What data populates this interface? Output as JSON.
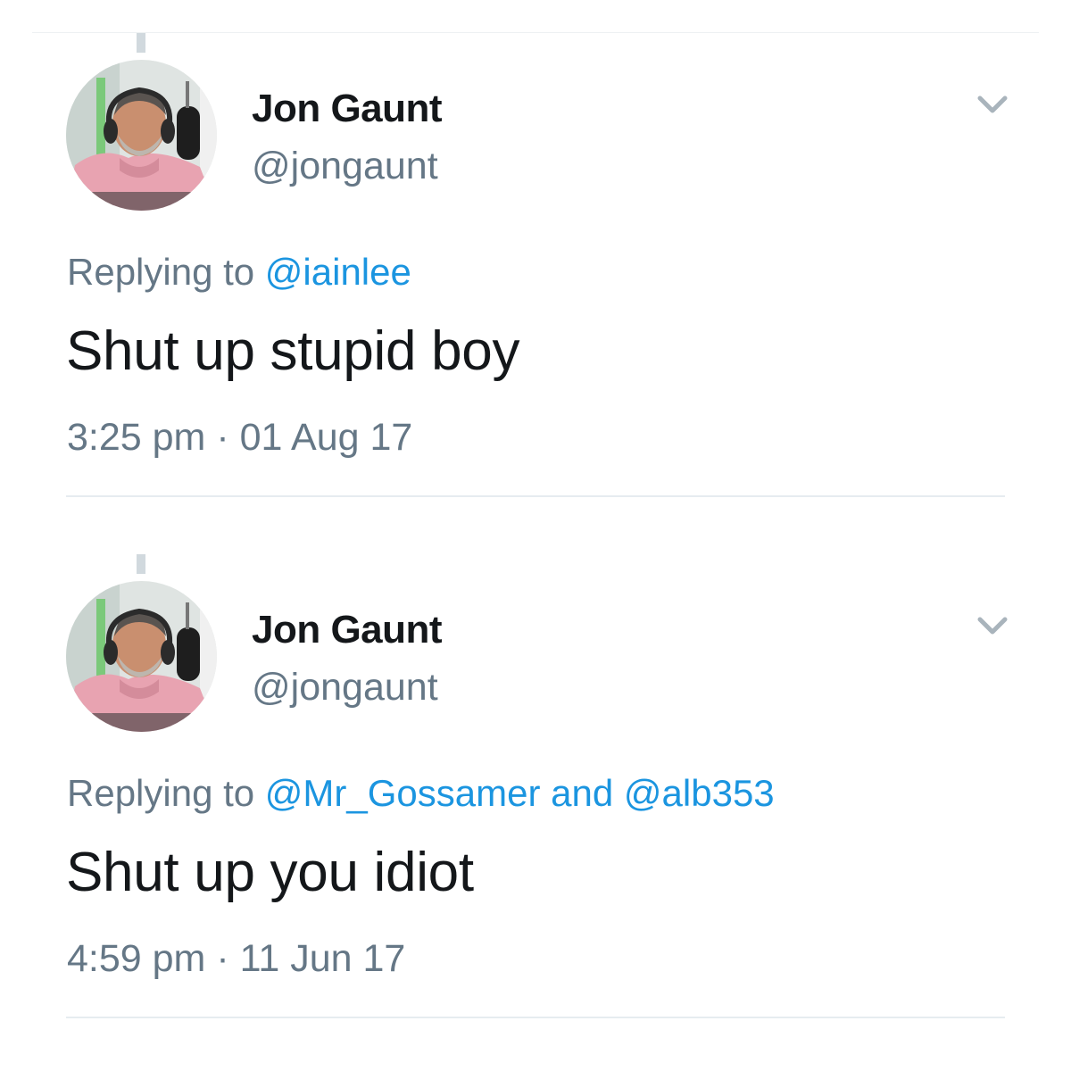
{
  "tweets": [
    {
      "author": {
        "display_name": "Jon Gaunt",
        "handle": "@jongaunt",
        "avatar_icon": "profile-photo"
      },
      "replying_prefix": "Replying to",
      "mentions": [
        "@iainlee"
      ],
      "mention_joiner": "",
      "text": "Shut up stupid boy",
      "time": "3:25 pm",
      "separator": "·",
      "date": "01 Aug 17",
      "menu_icon": "chevron-down-icon"
    },
    {
      "author": {
        "display_name": "Jon Gaunt",
        "handle": "@jongaunt",
        "avatar_icon": "profile-photo"
      },
      "replying_prefix": "Replying to",
      "mentions": [
        "@Mr_Gossamer",
        "@alb353"
      ],
      "mention_joiner": "and",
      "text": "Shut up you idiot",
      "time": "4:59 pm",
      "separator": "·",
      "date": "11 Jun 17",
      "menu_icon": "chevron-down-icon"
    }
  ],
  "colors": {
    "text_primary": "#14171a",
    "text_secondary": "#657786",
    "link": "#1b95e0",
    "divider": "#e6ecf0",
    "thread_line": "#d1d9de"
  }
}
